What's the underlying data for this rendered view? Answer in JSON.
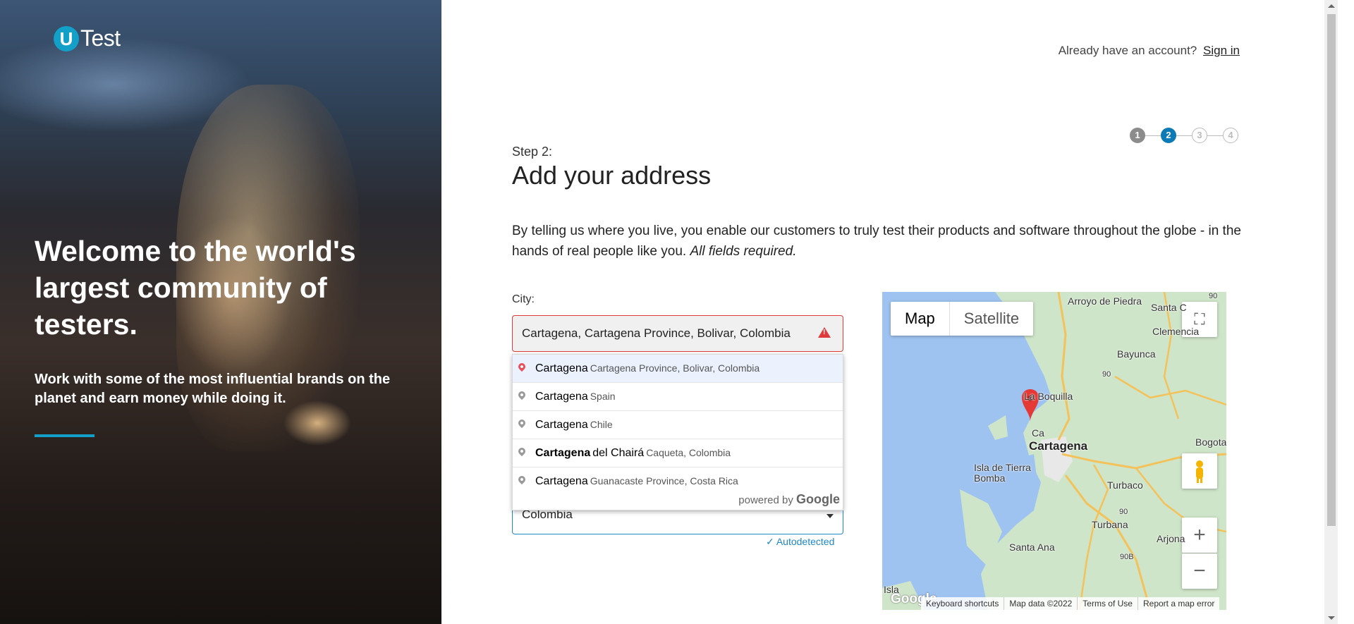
{
  "brand": {
    "logo_u": "U",
    "logo_text": "Test",
    "accent_color": "#12a0c8"
  },
  "hero": {
    "headline": "Welcome to the world's largest community of testers.",
    "subtext": "Work with some of the most influential brands on the planet and earn money while doing it."
  },
  "header": {
    "prompt": "Already have an account?",
    "signin_label": "Sign in"
  },
  "stepper": {
    "steps": [
      "1",
      "2",
      "3",
      "4"
    ],
    "current": 2
  },
  "form": {
    "step_label": "Step 2:",
    "title": "Add your address",
    "description": "By telling us where you live, you enable our customers to truly test their products and software throughout the globe - in the hands of real people like you.",
    "description_emphasis": "All fields required.",
    "city_label": "City:",
    "city_value": "Cartagena, Cartagena Province, Bolivar, Colombia",
    "city_state": "error",
    "country_value": "Colombia",
    "autodetected_label": "✓ Autodetected"
  },
  "autocomplete": {
    "items": [
      {
        "main": "Cartagena",
        "rest": "",
        "secondary": "Cartagena Province, Bolivar, Colombia"
      },
      {
        "main": "Cartagena",
        "rest": "",
        "secondary": "Spain"
      },
      {
        "main": "Cartagena",
        "rest": "",
        "secondary": "Chile"
      },
      {
        "main": "Cartagena",
        "rest": "del Chairá",
        "secondary": "Caqueta, Colombia"
      },
      {
        "main": "Cartagena",
        "rest": "",
        "secondary": "Guanacaste Province, Costa Rica"
      }
    ],
    "selected_index": 0,
    "powered_prefix": "powered by",
    "powered_brand": "Google"
  },
  "map": {
    "tab_map": "Map",
    "tab_satellite": "Satellite",
    "zoom_in": "+",
    "zoom_out": "−",
    "labels": {
      "arroyo": "Arroyo de Piedra",
      "santa_c": "Santa C",
      "clemencia": "Clemencia",
      "bayunca": "Bayunca",
      "route90a": "90",
      "la_boquilla": "La Boquilla",
      "cartagena": "Cartagena",
      "ca": "Ca",
      "bogota": "Bogota",
      "isla_tierra": "Isla de Tierra Bomba",
      "turbaco": "Turbaco",
      "route90b": "90",
      "turbana": "Turbana",
      "arjona": "Arjona",
      "santa_ana": "Santa Ana",
      "route90b2": "90B",
      "isla": "Isla",
      "top_num": "90"
    },
    "google_logo": "Google",
    "footer": [
      "Keyboard shortcuts",
      "Map data ©2022",
      "Terms of Use",
      "Report a map error"
    ],
    "land_color": "#cfe5c9",
    "water_color": "#9fc3f0",
    "marker_color": "#e53935"
  }
}
